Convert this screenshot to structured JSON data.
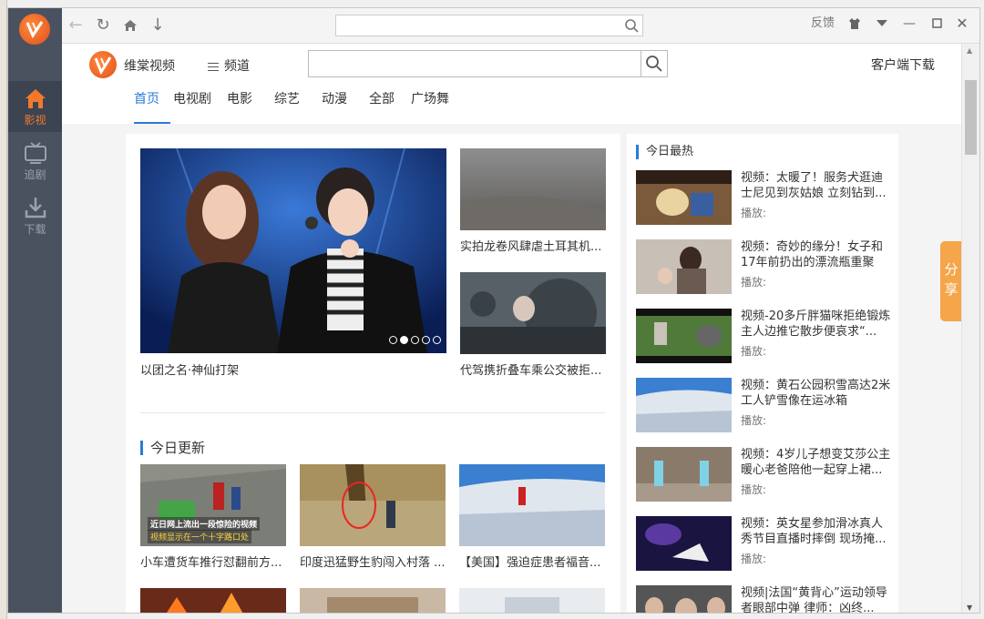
{
  "window": {
    "feedback_label": "反馈",
    "controls": [
      "minimize",
      "maximize",
      "close"
    ]
  },
  "sidebar": {
    "items": [
      {
        "label": "影视",
        "icon": "home-icon",
        "active": true
      },
      {
        "label": "追剧",
        "icon": "tv-icon",
        "active": false
      },
      {
        "label": "下载",
        "icon": "download-icon",
        "active": false
      }
    ]
  },
  "site": {
    "name": "维棠视频",
    "channel_label": "频道",
    "search_placeholder": "",
    "client_download": "客户端下载"
  },
  "tabs": [
    {
      "label": "首页",
      "active": true
    },
    {
      "label": "电视剧",
      "active": false
    },
    {
      "label": "电影",
      "active": false
    },
    {
      "label": "综艺",
      "active": false
    },
    {
      "label": "动漫",
      "active": false
    },
    {
      "label": "全部",
      "active": false
    },
    {
      "label": "广场舞",
      "active": false
    }
  ],
  "featured": {
    "hero_caption": "以团之名·神仙打架",
    "side": [
      {
        "caption": "实拍龙卷风肆虐土耳其机..."
      },
      {
        "caption": "代驾携折叠车乘公交被拒..."
      }
    ],
    "slide_count": 5,
    "active_slide": 1
  },
  "today_update": {
    "title": "今日更新",
    "items": [
      {
        "caption": "小车遭货车推行怼翻前方...",
        "overlay_line1": "近日网上流出一段惊险的视频",
        "overlay_line2": "视频显示在一个十字路口处"
      },
      {
        "caption": "印度迅猛野生豹闯入村落 ..."
      },
      {
        "caption": "【美国】强迫症患者福音..."
      }
    ]
  },
  "hot": {
    "title": "今日最热",
    "play_label": "播放:",
    "items": [
      {
        "title": "视频：太暖了！服务犬逛迪士尼见到灰姑娘 立刻钻到..."
      },
      {
        "title": "视频：奇妙的缘分！女子和17年前扔出的漂流瓶重聚"
      },
      {
        "title": "视频-20多斤胖猫咪拒绝锻炼 主人边推它散步便哀求“..."
      },
      {
        "title": "视频：黄石公园积雪高达2米 工人铲雪像在运冰箱"
      },
      {
        "title": "视频：4岁儿子想变艾莎公主 暖心老爸陪他一起穿上裙..."
      },
      {
        "title": "视频：英女星参加滑冰真人秀节目直播时摔倒 现场掩..."
      },
      {
        "title": "视频|法国“黄背心”运动领导者眼部中弹 律师：凶终..."
      }
    ]
  },
  "share_label": "分享",
  "colors": {
    "accent": "#2a7bd6",
    "brand_orange": "#f07a2a",
    "sidebar_bg": "#4a5260",
    "share_bg": "#f5a54a"
  }
}
